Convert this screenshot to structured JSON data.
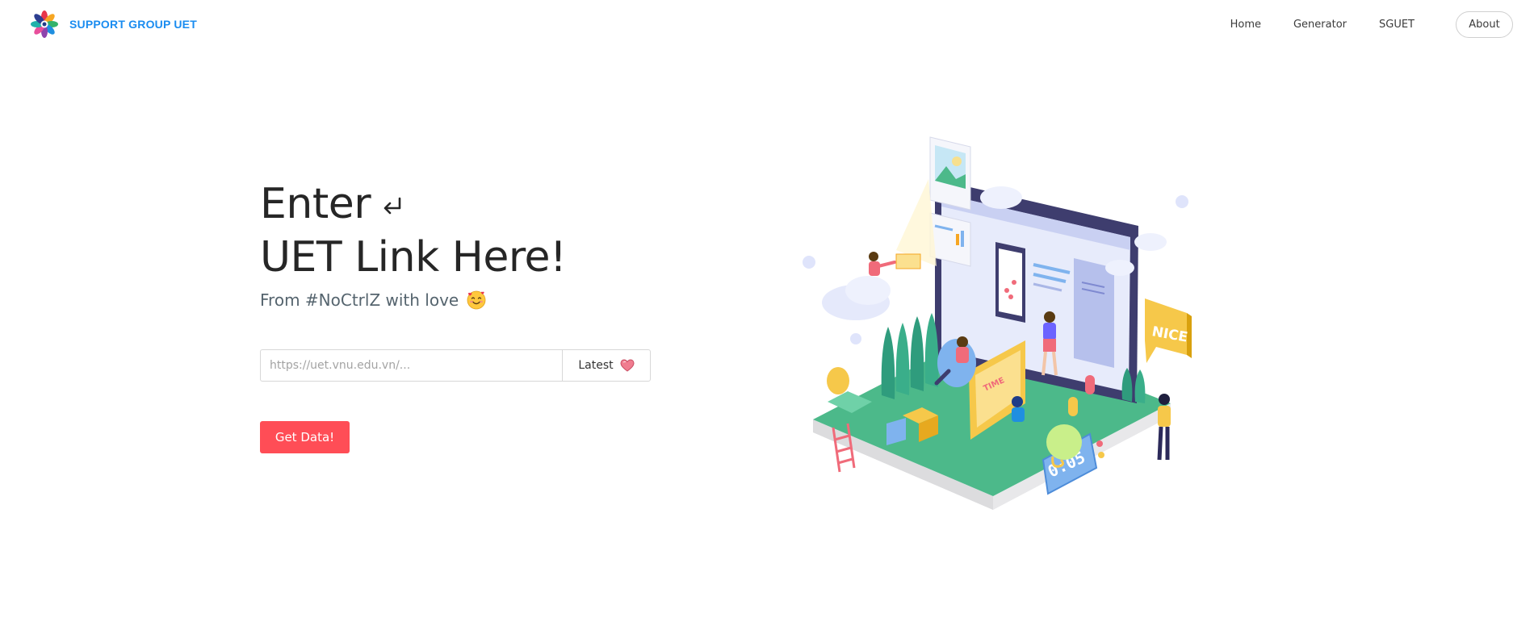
{
  "header": {
    "brand_name": "SUPPORT GROUP UET",
    "logo_icon": "flower-logo-icon",
    "nav": {
      "home": "Home",
      "generator": "Generator",
      "sguet": "SGUET",
      "about": "About"
    }
  },
  "hero": {
    "title_line1": "Enter",
    "title_line2": "UET Link Here!",
    "enter_icon": "return-arrow-icon",
    "subtitle": "From #NoCtrlZ with love",
    "subtitle_emoji": "smiling-face-with-hearts-emoji"
  },
  "form": {
    "link_placeholder": "https://uet.vnu.edu.vn/...",
    "link_value": "",
    "latest_label": "Latest",
    "latest_icon": "pink-heart-icon",
    "submit_label": "Get Data!"
  },
  "illustration": {
    "sign_text": "NICE",
    "clock_text": "0:05",
    "panel_text": "TIME"
  },
  "colors": {
    "brand": "#1a8cf0",
    "primary_button": "#ff4d56",
    "text_dark": "#262626",
    "text_muted": "#55646e",
    "ground_green": "#4cb98a"
  }
}
